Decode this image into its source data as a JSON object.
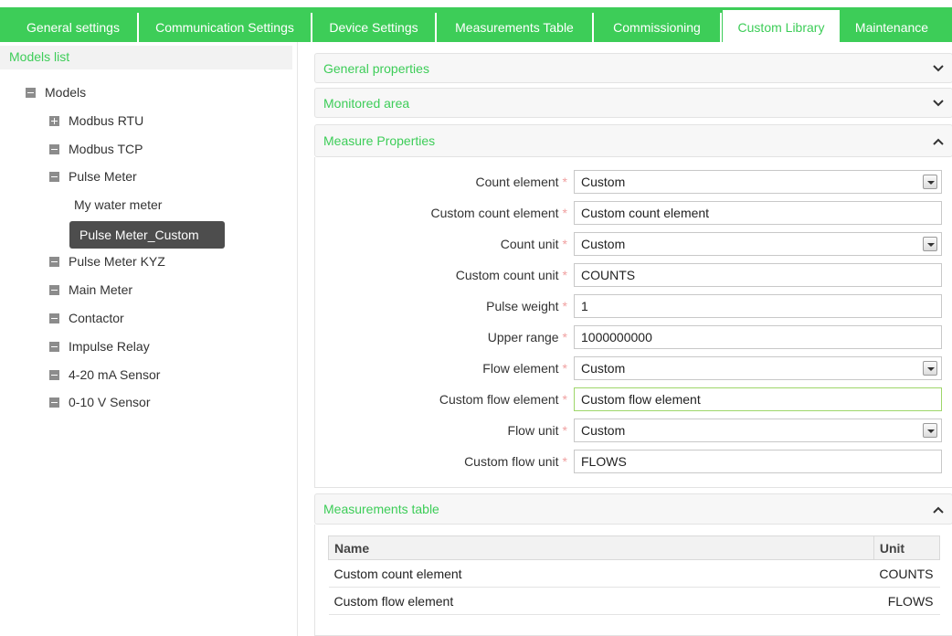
{
  "tabs": [
    {
      "label": "General settings"
    },
    {
      "label": "Communication Settings"
    },
    {
      "label": "Device Settings"
    },
    {
      "label": "Measurements Table"
    },
    {
      "label": "Commissioning"
    },
    {
      "label": "Custom Library"
    },
    {
      "label": "Maintenance"
    }
  ],
  "active_tab": "Custom Library",
  "sidebar": {
    "title": "Models list",
    "root": {
      "label": "Models",
      "icon": "minus-box-icon"
    },
    "items": [
      {
        "label": "Modbus RTU",
        "icon": "plus-box-icon"
      },
      {
        "label": "Modbus TCP",
        "icon": "minus-box-icon"
      },
      {
        "label": "Pulse Meter",
        "icon": "minus-box-icon"
      },
      {
        "label": "My water meter"
      },
      {
        "label": "Pulse Meter_Custom",
        "selected": true
      },
      {
        "label": "Pulse Meter KYZ",
        "icon": "minus-box-icon"
      },
      {
        "label": "Main Meter",
        "icon": "minus-box-icon"
      },
      {
        "label": "Contactor",
        "icon": "minus-box-icon"
      },
      {
        "label": "Impulse Relay",
        "icon": "minus-box-icon"
      },
      {
        "label": "4-20 mA Sensor",
        "icon": "minus-box-icon"
      },
      {
        "label": "0-10 V Sensor",
        "icon": "minus-box-icon"
      }
    ]
  },
  "sections": {
    "general": {
      "title": "General properties",
      "state": "collapsed"
    },
    "monitored": {
      "title": "Monitored area",
      "state": "collapsed"
    },
    "measure": {
      "title": "Measure Properties",
      "state": "expanded"
    },
    "measurements": {
      "title": "Measurements table",
      "state": "expanded"
    }
  },
  "required_mark": "*",
  "fields": [
    {
      "label": "Count element",
      "type": "select",
      "value": "Custom"
    },
    {
      "label": "Custom count element",
      "type": "input",
      "value": "Custom count element"
    },
    {
      "label": "Count unit",
      "type": "select",
      "value": "Custom"
    },
    {
      "label": "Custom count unit",
      "type": "input",
      "value": "COUNTS"
    },
    {
      "label": "Pulse weight",
      "type": "input",
      "value": "1"
    },
    {
      "label": "Upper range",
      "type": "input",
      "value": "1000000000"
    },
    {
      "label": "Flow element",
      "type": "select",
      "value": "Custom"
    },
    {
      "label": "Custom flow element",
      "type": "input",
      "value": "Custom flow element",
      "focused": true
    },
    {
      "label": "Flow unit",
      "type": "select",
      "value": "Custom"
    },
    {
      "label": "Custom flow unit",
      "type": "input",
      "value": "FLOWS"
    }
  ],
  "measurements_table": {
    "headers": {
      "name": "Name",
      "unit": "Unit"
    },
    "rows": [
      {
        "name": "Custom count element",
        "unit": "COUNTS"
      },
      {
        "name": "Custom flow element",
        "unit": "FLOWS"
      }
    ]
  },
  "colors": {
    "accent": "#3dcd58",
    "selected_bg": "#4d4d4d",
    "required": "#f0a0a0"
  }
}
